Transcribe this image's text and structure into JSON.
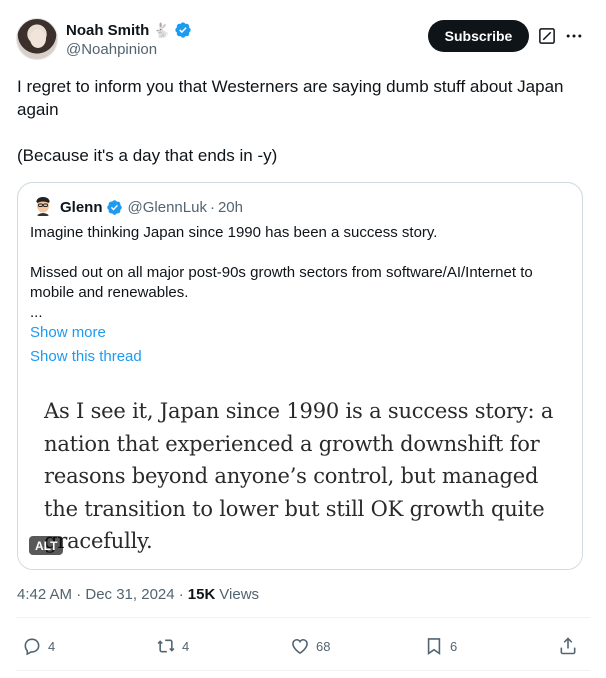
{
  "author": {
    "name": "Noah Smith",
    "emoji": "🐇",
    "handle": "@Noahpinion"
  },
  "buttons": {
    "subscribe": "Subscribe"
  },
  "icons": {
    "verified": "verified-badge-icon",
    "grok": "grok-icon",
    "more": "more-icon",
    "reply": "reply-icon",
    "repost": "repost-icon",
    "like": "like-icon",
    "bookmark": "bookmark-icon",
    "share": "share-icon"
  },
  "tweet": {
    "line1": "I regret to inform you that Westerners are saying dumb stuff about Japan again",
    "line2": "(Because it's a day that ends in -y)"
  },
  "quote": {
    "name": "Glenn",
    "handle": "@GlennLuk",
    "dot": "·",
    "time": "20h",
    "p1": "Imagine thinking Japan since 1990 has been a success story.",
    "p2": "Missed out on all major post-90s growth sectors from software/AI/Internet to mobile and renewables.",
    "p3": "...",
    "show_more": "Show more",
    "show_thread": "Show this thread",
    "image_text": "As I see it, Japan since 1990 is a success story: a nation that experienced a growth downshift for reasons beyond anyone’s control, but managed the transition to lower but still OK growth quite gracefully.",
    "alt": "ALT"
  },
  "meta": {
    "time": "4:42 AM · Dec 31, 2024 ·",
    "views_count": "15K",
    "views_label": "Views"
  },
  "actions": {
    "replies": "4",
    "reposts": "4",
    "likes": "68",
    "bookmarks": "6"
  },
  "colors": {
    "accent": "#1d9bf0",
    "text": "#0f1419",
    "secondary": "#536471",
    "border": "#cfd9de"
  }
}
